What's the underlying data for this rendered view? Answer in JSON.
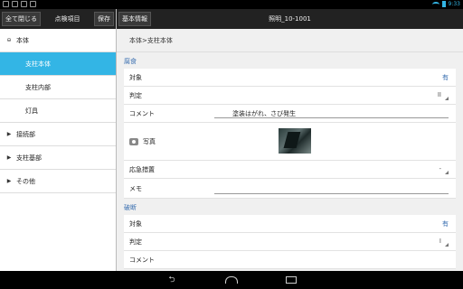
{
  "status_bar": {
    "time": "9:33",
    "left_icons": [
      "sd-card-icon",
      "image-icon",
      "download-icon",
      "briefcase-icon"
    ]
  },
  "left_panel": {
    "close_all_label": "全て閉じる",
    "title": "点検項目",
    "save_label": "保存",
    "tree": [
      {
        "label": "本体",
        "level": 0,
        "expanded": true
      },
      {
        "label": "支柱本体",
        "level": 1,
        "selected": true
      },
      {
        "label": "支柱内部",
        "level": 1
      },
      {
        "label": "灯具",
        "level": 1
      },
      {
        "label": "接続部",
        "level": 0,
        "expanded": false
      },
      {
        "label": "支柱基部",
        "level": 0,
        "expanded": false
      },
      {
        "label": "その他",
        "level": 0,
        "expanded": false
      }
    ]
  },
  "right_panel": {
    "basic_info_label": "基本情報",
    "title": "照明_10-1001",
    "breadcrumb": "本体>支柱本体",
    "sections": [
      {
        "header": "腐食",
        "rows": {
          "target_label": "対象",
          "target_value": "有",
          "judgement_label": "判定",
          "judgement_value": "II",
          "comment_label": "コメント",
          "comment_value": "塗装はがれ、さび発生",
          "photo_label": "写真",
          "emergency_label": "応急措置",
          "emergency_value": "-",
          "memo_label": "メモ"
        }
      },
      {
        "header": "破断",
        "rows": {
          "target_label": "対象",
          "target_value": "有",
          "judgement_label": "判定",
          "judgement_value": "I",
          "comment_label": "コメント"
        }
      }
    ]
  },
  "colors": {
    "accent": "#33b5e5",
    "section_header": "#3a6fb0",
    "toolbar": "#222222"
  }
}
